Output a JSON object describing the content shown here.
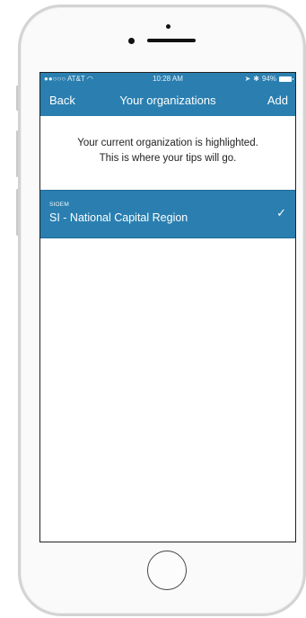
{
  "status_bar": {
    "carrier": "●●○○○ AT&T",
    "wifi_icon": "wifi-icon",
    "time": "10:28 AM",
    "battery_text": "94%"
  },
  "navbar": {
    "back_label": "Back",
    "title": "Your organizations",
    "add_label": "Add",
    "background_color": "#2a7fb0"
  },
  "intro": {
    "line1": "Your current organization is highlighted.",
    "line2": "This is where your tips will go."
  },
  "organizations": [
    {
      "code": "SIOEM",
      "name": "SI - National Capital Region",
      "selected": true,
      "check_icon": "checkmark-icon"
    }
  ]
}
